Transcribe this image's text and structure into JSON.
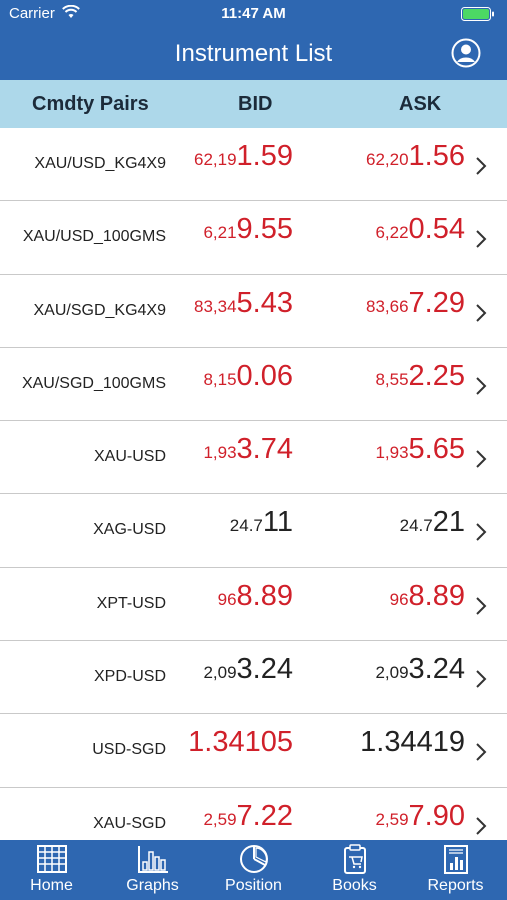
{
  "status": {
    "carrier": "Carrier",
    "time": "11:47 AM"
  },
  "nav": {
    "title": "Instrument List"
  },
  "columns": {
    "pair": "Cmdty Pairs",
    "bid": "BID",
    "ask": "ASK"
  },
  "colors": {
    "primary": "#2e67b1",
    "header_bg": "#add8ea",
    "price_red": "#d0202a",
    "price_dark": "#222222"
  },
  "rows": [
    {
      "pair": "XAU/USD_KG4X9",
      "bid_prefix": "62,19",
      "bid_main": "1.59",
      "ask_prefix": "62,20",
      "ask_main": "1.56",
      "color": "red"
    },
    {
      "pair": "XAU/USD_100GMS",
      "bid_prefix": "6,21",
      "bid_main": "9.55",
      "ask_prefix": "6,22",
      "ask_main": "0.54",
      "color": "red"
    },
    {
      "pair": "XAU/SGD_KG4X9",
      "bid_prefix": "83,34",
      "bid_main": "5.43",
      "ask_prefix": "83,66",
      "ask_main": "7.29",
      "color": "red"
    },
    {
      "pair": "XAU/SGD_100GMS",
      "bid_prefix": "8,15",
      "bid_main": "0.06",
      "ask_prefix": "8,55",
      "ask_main": "2.25",
      "color": "red"
    },
    {
      "pair": "XAU-USD",
      "bid_prefix": "1,93",
      "bid_main": "3.74",
      "ask_prefix": "1,93",
      "ask_main": "5.65",
      "color": "red"
    },
    {
      "pair": "XAG-USD",
      "bid_prefix": "24.7",
      "bid_main": "11",
      "ask_prefix": "24.7",
      "ask_main": "21",
      "color": "dark"
    },
    {
      "pair": "XPT-USD",
      "bid_prefix": "96",
      "bid_main": "8.89",
      "ask_prefix": "96",
      "ask_main": "8.89",
      "color": "red"
    },
    {
      "pair": "XPD-USD",
      "bid_prefix": "2,09",
      "bid_main": "3.24",
      "ask_prefix": "2,09",
      "ask_main": "3.24",
      "color": "dark"
    },
    {
      "pair": "USD-SGD",
      "bid_prefix": "",
      "bid_main": "1.34105",
      "ask_prefix": "",
      "ask_main": "1.34419",
      "color": "red",
      "ask_color": "dark"
    },
    {
      "pair": "XAU-SGD",
      "bid_prefix": "2,59",
      "bid_main": "7.22",
      "ask_prefix": "2,59",
      "ask_main": "7.90",
      "color": "red"
    }
  ],
  "tabs": [
    {
      "label": "Home",
      "icon": "grid-icon"
    },
    {
      "label": "Graphs",
      "icon": "bar-chart-icon"
    },
    {
      "label": "Position",
      "icon": "pie-chart-icon"
    },
    {
      "label": "Books",
      "icon": "clipboard-icon"
    },
    {
      "label": "Reports",
      "icon": "report-icon"
    }
  ]
}
